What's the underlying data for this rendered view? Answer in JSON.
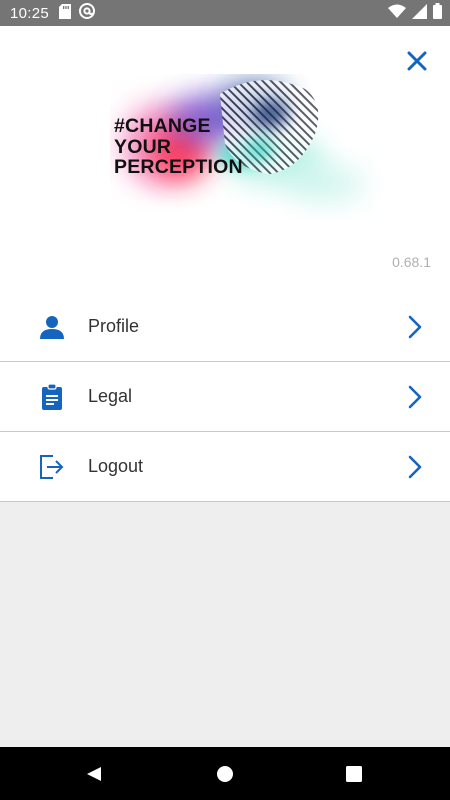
{
  "status_bar": {
    "time": "10:25",
    "left_icons": [
      "sd-card-icon",
      "at-sign-icon"
    ],
    "right_icons": [
      "wifi-icon",
      "cellular-signal-icon",
      "battery-icon"
    ]
  },
  "header": {
    "close_icon": "close-icon",
    "logo_lines": [
      "#CHANGE",
      "YOUR",
      "PERCEPTION"
    ],
    "version": "0.68.1"
  },
  "menu": {
    "items": [
      {
        "label": "Profile",
        "icon": "person-icon"
      },
      {
        "label": "Legal",
        "icon": "clipboard-icon"
      },
      {
        "label": "Logout",
        "icon": "logout-icon"
      }
    ]
  },
  "nav_bar": {
    "buttons": [
      "back-icon",
      "home-icon",
      "recents-icon"
    ]
  },
  "colors": {
    "accent": "#1565c0",
    "status_bar": "#757575",
    "background": "#eeeeee",
    "divider": "#c8c8c8",
    "text": "#333333",
    "version_text": "#b0b0b0"
  }
}
